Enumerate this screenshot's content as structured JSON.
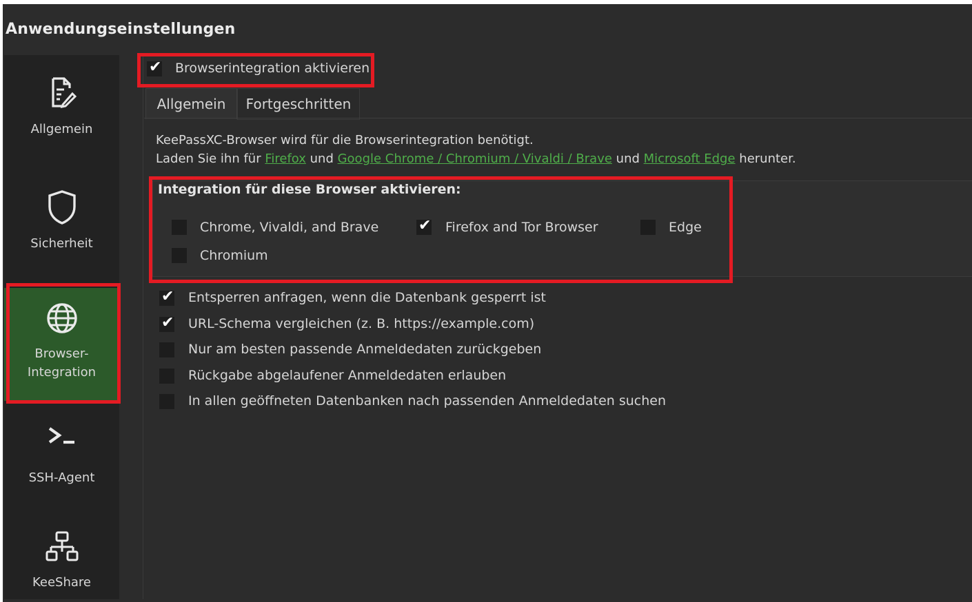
{
  "page_title": "Anwendungseinstellungen",
  "sidebar": {
    "items": [
      {
        "label": "Allgemein",
        "icon": "edit-document-icon"
      },
      {
        "label": "Sicherheit",
        "icon": "shield-icon"
      },
      {
        "label_line1": "Browser-",
        "label_line2": "Integration",
        "icon": "globe-icon",
        "active": true
      },
      {
        "label": "SSH-Agent",
        "icon": "terminal-icon"
      },
      {
        "label": "KeeShare",
        "icon": "network-share-icon"
      }
    ]
  },
  "enable_browser_integration": {
    "label": "Browserintegration aktivieren",
    "checked": true
  },
  "tabs": [
    {
      "label": "Allgemein",
      "active": true
    },
    {
      "label": "Fortgeschritten",
      "active": false
    }
  ],
  "info": {
    "line1": "KeePassXC-Browser wird für die Browserintegration benötigt.",
    "line2_prefix": "Laden Sie ihn für ",
    "link_firefox": "Firefox",
    "und1": " und ",
    "link_chrome": "Google Chrome / Chromium / Vivaldi / Brave",
    "und2": " und ",
    "link_edge": "Microsoft Edge",
    "line2_suffix": " herunter."
  },
  "browser_group": {
    "title": "Integration für diese Browser aktivieren:",
    "browsers": [
      {
        "label": "Chrome, Vivaldi, and Brave",
        "checked": false
      },
      {
        "label": "Firefox and Tor Browser",
        "checked": true
      },
      {
        "label": "Edge",
        "checked": false
      },
      {
        "label": "Chromium",
        "checked": false
      }
    ]
  },
  "options": [
    {
      "label": "Entsperren anfragen, wenn die Datenbank gesperrt ist",
      "checked": true
    },
    {
      "label": "URL-Schema vergleichen (z. B. https://example.com)",
      "checked": true
    },
    {
      "label": "Nur am besten passende Anmeldedaten zurückgeben",
      "checked": false
    },
    {
      "label": "Rückgabe abgelaufener Anmeldedaten erlauben",
      "checked": false
    },
    {
      "label": "In allen geöffneten Datenbanken nach passenden Anmeldedaten suchen",
      "checked": false
    }
  ],
  "check_glyph": "✔",
  "colors": {
    "accent_green": "#2c5a2a",
    "link_green": "#4fae4a",
    "highlight_red": "#e41b23"
  }
}
